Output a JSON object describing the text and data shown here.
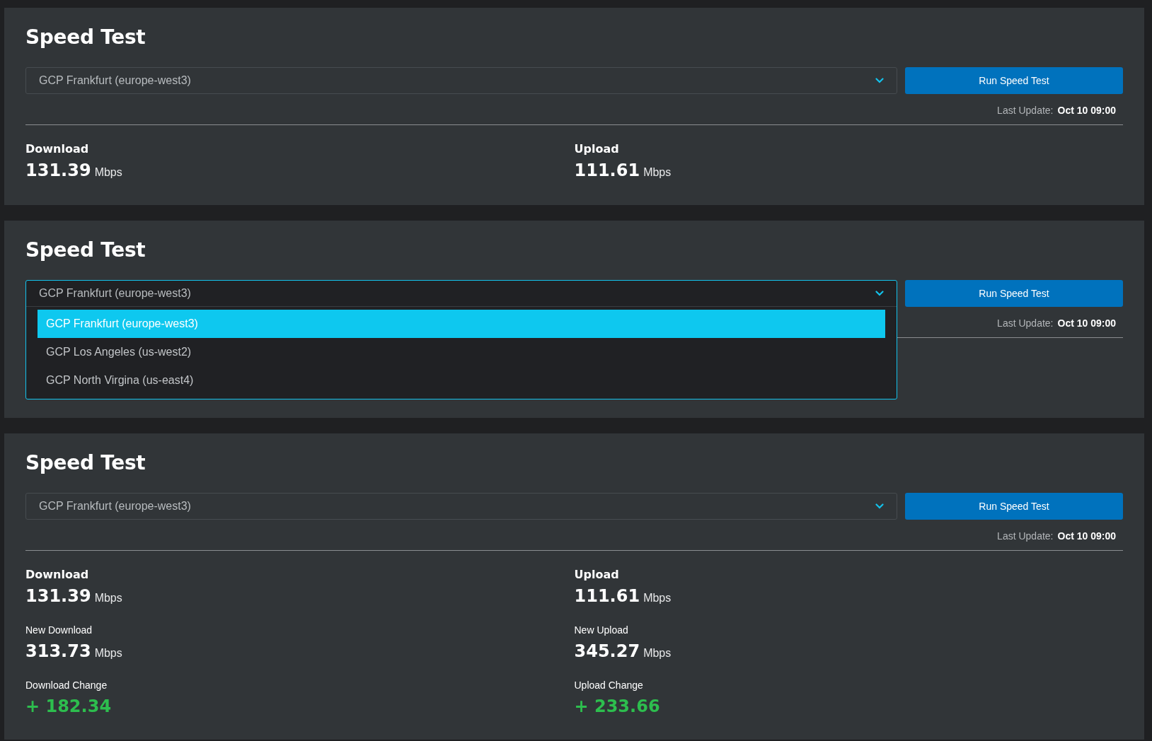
{
  "panels": [
    {
      "title": "Speed Test",
      "select": {
        "value": "GCP Frankfurt (europe-west3)",
        "expanded": false
      },
      "button": "Run Speed Test",
      "last_update": {
        "label": "Last Update:",
        "value": "Oct 10 09:00"
      },
      "metrics": [
        {
          "kind": "base",
          "label": "Download",
          "value": "131.39",
          "unit": "Mbps"
        },
        {
          "kind": "base",
          "label": "Upload",
          "value": "111.61",
          "unit": "Mbps"
        }
      ]
    },
    {
      "title": "Speed Test",
      "select": {
        "value": "GCP Frankfurt (europe-west3)",
        "expanded": true,
        "options": [
          {
            "label": "GCP Frankfurt (europe-west3)",
            "selected": true
          },
          {
            "label": "GCP Los Angeles (us-west2)",
            "selected": false
          },
          {
            "label": "GCP North Virgina (us-east4)",
            "selected": false
          }
        ]
      },
      "button": "Run Speed Test",
      "last_update": {
        "label": "Last Update:",
        "value": "Oct 10 09:00"
      }
    },
    {
      "title": "Speed Test",
      "select": {
        "value": "GCP Frankfurt (europe-west3)",
        "expanded": false
      },
      "button": "Run Speed Test",
      "last_update": {
        "label": "Last Update:",
        "value": "Oct 10 09:00"
      },
      "metrics": [
        {
          "kind": "base",
          "label": "Download",
          "value": "131.39",
          "unit": "Mbps"
        },
        {
          "kind": "base",
          "label": "Upload",
          "value": "111.61",
          "unit": "Mbps"
        },
        {
          "kind": "new",
          "label": "New Download",
          "value": "313.73",
          "unit": "Mbps"
        },
        {
          "kind": "new",
          "label": "New Upload",
          "value": "345.27",
          "unit": "Mbps"
        },
        {
          "kind": "change",
          "label": "Download Change",
          "value": "+ 182.34"
        },
        {
          "kind": "change",
          "label": "Upload Change",
          "value": "+ 233.66"
        }
      ]
    }
  ]
}
